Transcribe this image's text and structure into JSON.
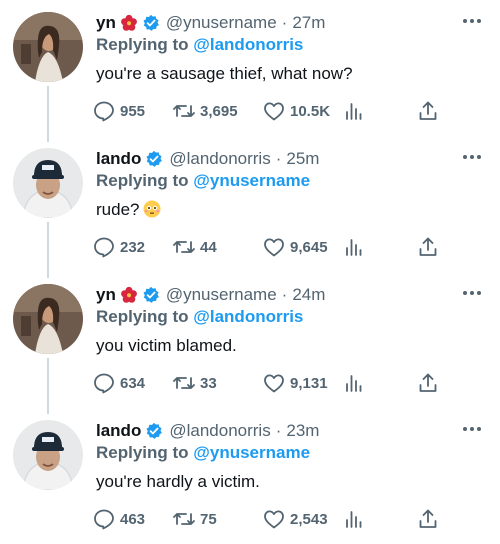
{
  "tweets": [
    {
      "name": "yn",
      "handle": "@ynusername",
      "time": "27m",
      "replying_label": "Replying to",
      "replying_to": "@landonorris",
      "text": "you're a sausage thief, what now?",
      "replies": "955",
      "retweets": "3,695",
      "likes": "10.5K",
      "avatar": "woman-photo-avatar",
      "flower_emoji": true
    },
    {
      "name": "lando",
      "handle": "@landonorris",
      "time": "25m",
      "replying_label": "Replying to",
      "replying_to": "@ynusername",
      "text": "rude?",
      "text_emoji": "flushed-face",
      "replies": "232",
      "retweets": "44",
      "likes": "9,645",
      "avatar": "man-cap-hoodie-avatar",
      "flower_emoji": false
    },
    {
      "name": "yn",
      "handle": "@ynusername",
      "time": "24m",
      "replying_label": "Replying to",
      "replying_to": "@landonorris",
      "text": "you victim blamed.",
      "replies": "634",
      "retweets": "33",
      "likes": "9,131",
      "avatar": "woman-photo-avatar",
      "flower_emoji": true
    },
    {
      "name": "lando",
      "handle": "@landonorris",
      "time": "23m",
      "replying_label": "Replying to",
      "replying_to": "@ynusername",
      "text": "you're hardly a victim.",
      "replies": "463",
      "retweets": "75",
      "likes": "2,543",
      "avatar": "man-cap-hoodie-avatar",
      "flower_emoji": false
    }
  ],
  "separator": "·",
  "colors": {
    "link_blue": "#1d9bf0",
    "secondary_text": "#536471",
    "primary_text": "#0f1419",
    "verified_blue": "#1d9bf0",
    "thread_line": "#cfd9de"
  },
  "icons": [
    "reply-icon",
    "retweet-icon",
    "like-icon",
    "views-icon",
    "share-icon",
    "more-icon",
    "verified-badge-icon",
    "hibiscus-emoji-icon",
    "flushed-face-emoji-icon"
  ]
}
